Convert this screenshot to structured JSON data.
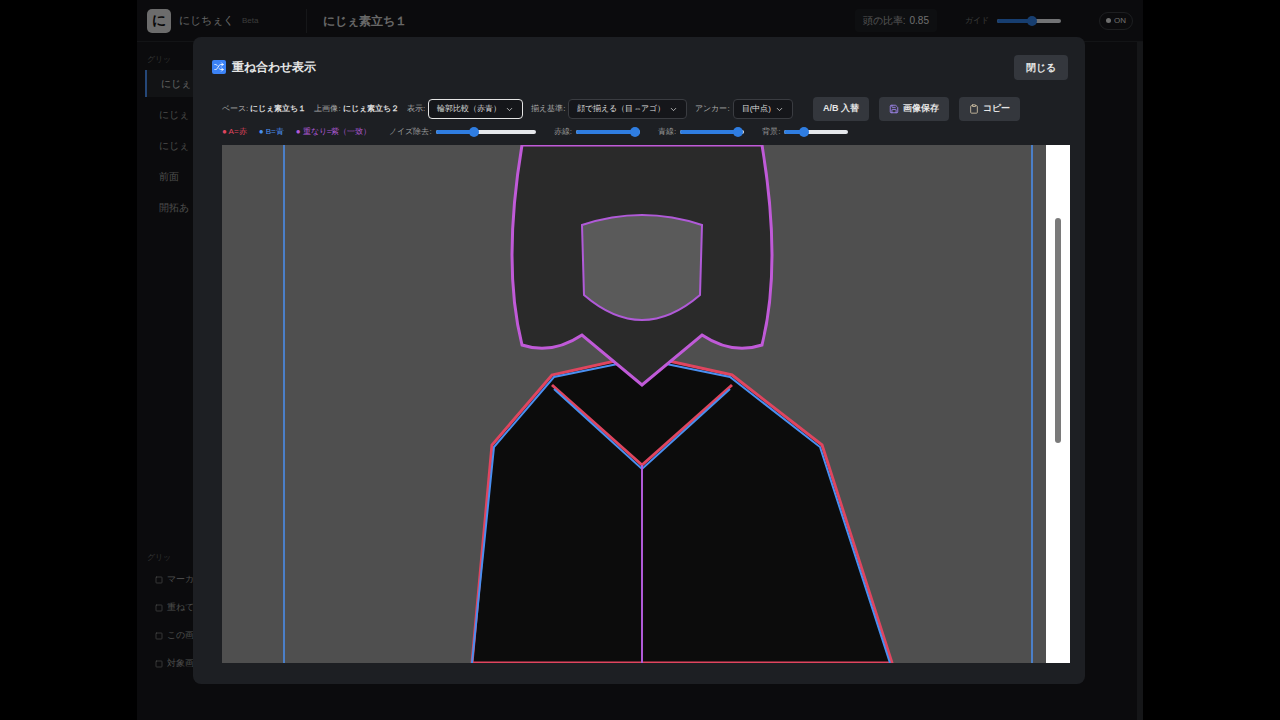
{
  "app": {
    "logo": "に",
    "name": "にじちぇく",
    "badge": "Beta",
    "document": "にじぇ素立ち１",
    "head_ratio": {
      "label": "頭の比率:",
      "value": "0.85"
    },
    "guide": {
      "label": "ガイド",
      "level": 0.55
    },
    "toggle": {
      "label": "ON",
      "on": true
    }
  },
  "sidebar": {
    "heading": "グリッ",
    "items": [
      {
        "label": "にじぇ",
        "selected": true
      },
      {
        "label": "にじぇ",
        "selected": false
      },
      {
        "label": "にじぇ",
        "selected": false
      },
      {
        "label": "前面",
        "selected": false
      },
      {
        "label": "開拓あ",
        "selected": false
      }
    ],
    "section": "グリッ",
    "actions": [
      "マーカ",
      "重ねて",
      "この画像",
      "対象画"
    ]
  },
  "modal": {
    "title": "重ね合わせ表示",
    "close": "閉じる",
    "base": {
      "label": "ベース:",
      "value": "にじぇ素立ち１"
    },
    "top": {
      "label": "上画像:",
      "value": "にじぇ素立ち２"
    },
    "selects": [
      {
        "label": "表示:",
        "value": "輪郭比較（赤青）",
        "focused": true
      },
      {
        "label": "揃え基準:",
        "value": "顔で揃える（目⇔アゴ）",
        "focused": false
      },
      {
        "label": "アンカー:",
        "value": "目(中点)",
        "focused": false
      }
    ],
    "buttons": [
      {
        "label": "A/B 入替",
        "kind": "text"
      },
      {
        "label": "画像保存",
        "kind": "save"
      },
      {
        "label": "コピー",
        "kind": "copy"
      }
    ],
    "legend": [
      {
        "label": "● A=赤",
        "color": "#e0455f"
      },
      {
        "label": "● B=青",
        "color": "#4a8ff0"
      },
      {
        "label": "● 重なり=紫（一致）",
        "color": "#b05ad8"
      }
    ],
    "sliders": [
      {
        "label": "ノイズ除去:",
        "level": 0.38
      },
      {
        "label": "赤線:",
        "level": 0.92
      },
      {
        "label": "青線:",
        "level": 0.9
      },
      {
        "label": "背景:",
        "level": 0.3
      }
    ],
    "scroll": {
      "level": 0.3
    }
  }
}
